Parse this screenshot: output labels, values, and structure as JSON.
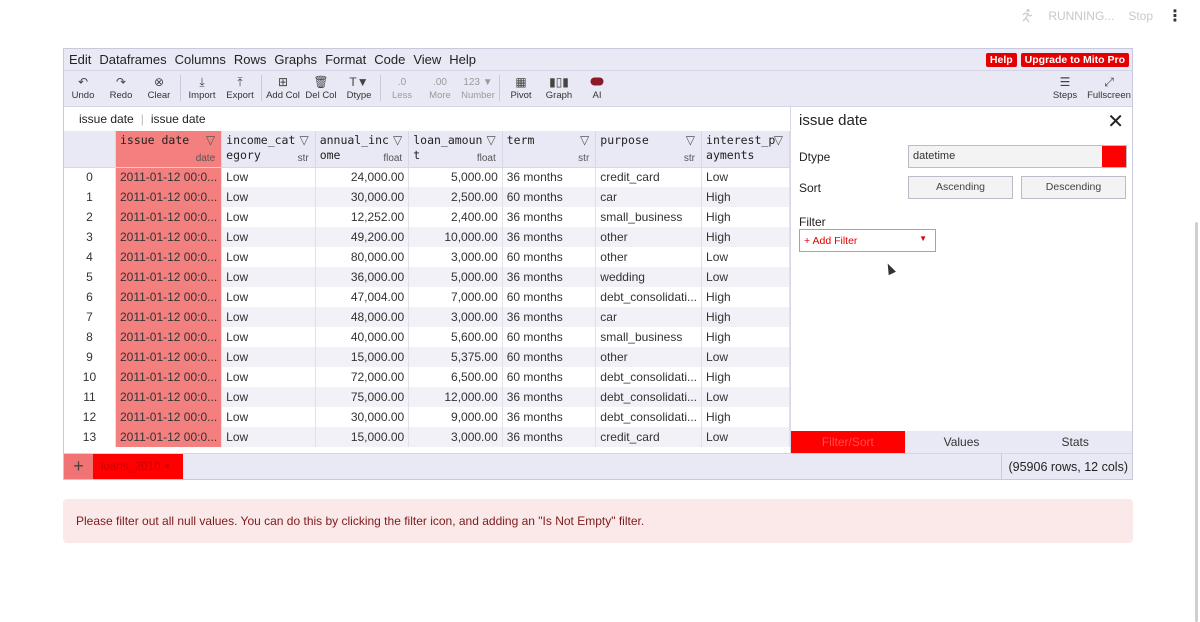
{
  "topbar": {
    "status": "RUNNING...",
    "stop_label": "Stop"
  },
  "menu": [
    "Edit",
    "Dataframes",
    "Columns",
    "Rows",
    "Graphs",
    "Format",
    "Code",
    "View",
    "Help"
  ],
  "menu_right": {
    "help": "Help",
    "upgrade": "Upgrade to Mito Pro"
  },
  "toolbar": {
    "undo": "Undo",
    "redo": "Redo",
    "clear": "Clear",
    "import": "Import",
    "export": "Export",
    "add_col": "Add Col",
    "del_col": "Del Col",
    "dtype": "Dtype",
    "dtype_icon": "T▼",
    "less": "Less",
    "less_icon": ".0",
    "more": "More",
    "more_icon": ".00",
    "number": "Number",
    "number_icon": "123 ▼",
    "pivot": "Pivot",
    "graph": "Graph",
    "ai": "AI",
    "steps": "Steps",
    "fullscreen": "Fullscreen"
  },
  "formula_bar": {
    "column": "issue date",
    "value": "issue date"
  },
  "columns": [
    {
      "name": "issue date",
      "type": "date"
    },
    {
      "name": "income_category",
      "type": "str"
    },
    {
      "name": "annual_income",
      "type": "float"
    },
    {
      "name": "loan_amount",
      "type": "float"
    },
    {
      "name": "term",
      "type": "str"
    },
    {
      "name": "purpose",
      "type": "str"
    },
    {
      "name": "interest_payments",
      "type": ""
    }
  ],
  "rows": [
    [
      "0",
      "2011-01-12 00:0...",
      "Low",
      "24,000.00",
      "5,000.00",
      "36 months",
      "credit_card",
      "Low"
    ],
    [
      "1",
      "2011-01-12 00:0...",
      "Low",
      "30,000.00",
      "2,500.00",
      "60 months",
      "car",
      "High"
    ],
    [
      "2",
      "2011-01-12 00:0...",
      "Low",
      "12,252.00",
      "2,400.00",
      "36 months",
      "small_business",
      "High"
    ],
    [
      "3",
      "2011-01-12 00:0...",
      "Low",
      "49,200.00",
      "10,000.00",
      "36 months",
      "other",
      "High"
    ],
    [
      "4",
      "2011-01-12 00:0...",
      "Low",
      "80,000.00",
      "3,000.00",
      "60 months",
      "other",
      "Low"
    ],
    [
      "5",
      "2011-01-12 00:0...",
      "Low",
      "36,000.00",
      "5,000.00",
      "36 months",
      "wedding",
      "Low"
    ],
    [
      "6",
      "2011-01-12 00:0...",
      "Low",
      "47,004.00",
      "7,000.00",
      "60 months",
      "debt_consolidati...",
      "High"
    ],
    [
      "7",
      "2011-01-12 00:0...",
      "Low",
      "48,000.00",
      "3,000.00",
      "36 months",
      "car",
      "High"
    ],
    [
      "8",
      "2011-01-12 00:0...",
      "Low",
      "40,000.00",
      "5,600.00",
      "60 months",
      "small_business",
      "High"
    ],
    [
      "9",
      "2011-01-12 00:0...",
      "Low",
      "15,000.00",
      "5,375.00",
      "60 months",
      "other",
      "Low"
    ],
    [
      "10",
      "2011-01-12 00:0...",
      "Low",
      "72,000.00",
      "6,500.00",
      "60 months",
      "debt_consolidati...",
      "High"
    ],
    [
      "11",
      "2011-01-12 00:0...",
      "Low",
      "75,000.00",
      "12,000.00",
      "36 months",
      "debt_consolidati...",
      "Low"
    ],
    [
      "12",
      "2011-01-12 00:0...",
      "Low",
      "30,000.00",
      "9,000.00",
      "36 months",
      "debt_consolidati...",
      "High"
    ],
    [
      "13",
      "2011-01-12 00:0...",
      "Low",
      "15,000.00",
      "3,000.00",
      "36 months",
      "credit_card",
      "Low"
    ]
  ],
  "side_panel": {
    "title": "issue date",
    "dtype_label": "Dtype",
    "dtype_value": "datetime",
    "sort_label": "Sort",
    "ascending": "Ascending",
    "descending": "Descending",
    "filter_label": "Filter",
    "add_filter": "+ Add Filter",
    "tabs": [
      "Filter/Sort",
      "Values",
      "Stats"
    ]
  },
  "footer": {
    "add": "+",
    "sheet_name": "loans_2010",
    "row_count": "(95906 rows, 12 cols)"
  },
  "alert": "Please filter out all null values. You can do this by clicking the filter icon, and adding an \"Is Not Empty\" filter.",
  "colors": {
    "accent_red": "#ff0000",
    "selected_column": "#f47f7f",
    "panel_bg": "#e9e9f5",
    "alert_bg": "#fbe9ea"
  }
}
